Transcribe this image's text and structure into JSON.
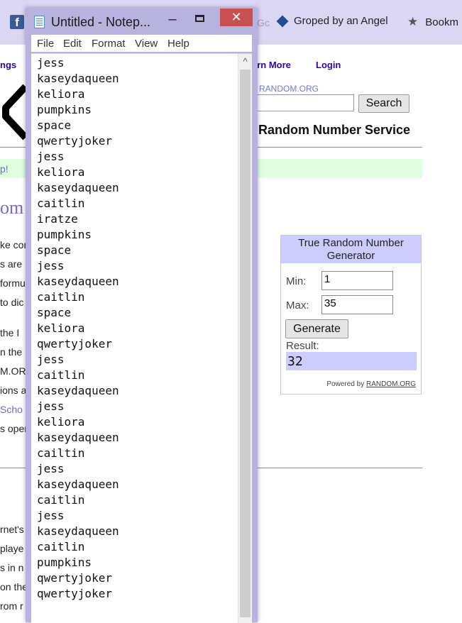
{
  "bookmarks": {
    "fb_letter": "f",
    "fragment": "Gc",
    "items": [
      {
        "label": "Groped by an Angel",
        "icon": "bookmark-diamond-icon"
      },
      {
        "label": "Bookm",
        "icon": "star-icon"
      }
    ]
  },
  "page": {
    "nav": {
      "fragment": "ngs",
      "learn_more": "arn More",
      "login": "Login"
    },
    "search": {
      "with_label": "h RANDOM.ORG",
      "button": "Search"
    },
    "service_title": "Random Number Service",
    "green_text": "p!",
    "heading_fragment": "om",
    "body_fragments": [
      "ke cor",
      "s are",
      "formu",
      "to dic",
      "the I",
      "n the",
      "M.ORC",
      "ions a",
      "Scho",
      "s oper",
      "rnet's",
      "playe",
      "s in n",
      "on the",
      "rom r"
    ],
    "colors": {
      "link": "#3300aa",
      "accent": "#ccccff",
      "green": "#dfffdf"
    }
  },
  "widget": {
    "title": "True Random Number Generator",
    "min_label": "Min:",
    "min_value": "1",
    "max_label": "Max:",
    "max_value": "35",
    "generate": "Generate",
    "result_label": "Result:",
    "result_value": "32",
    "powered_by": "Powered by",
    "powered_link": "RANDOM.ORG"
  },
  "notepad": {
    "title": "Untitled - Notep...",
    "controls": {
      "minimize": "–",
      "close": "✕"
    },
    "menu": [
      "File",
      "Edit",
      "Format",
      "View",
      "Help"
    ],
    "scroll_up": "^",
    "lines": [
      "jess",
      "kaseydaqueen",
      "keliora",
      "pumpkins",
      "space",
      "qwertyjoker",
      "jess",
      "keliora",
      "kaseydaqueen",
      "caitlin",
      "iratze",
      "pumpkins",
      "space",
      "jess",
      "kaseydaqueen",
      "caitlin",
      "space",
      "keliora",
      "qwertyjoker",
      "jess",
      "caitlin",
      "kaseydaqueen",
      "jess",
      "keliora",
      "kaseydaqueen",
      "cailtin",
      "jess",
      "kaseydaqueen",
      "caitlin",
      "jess",
      "kaseydaqueen",
      "caitlin",
      "pumpkins",
      "qwertyjoker",
      "qwertyjoker"
    ]
  }
}
